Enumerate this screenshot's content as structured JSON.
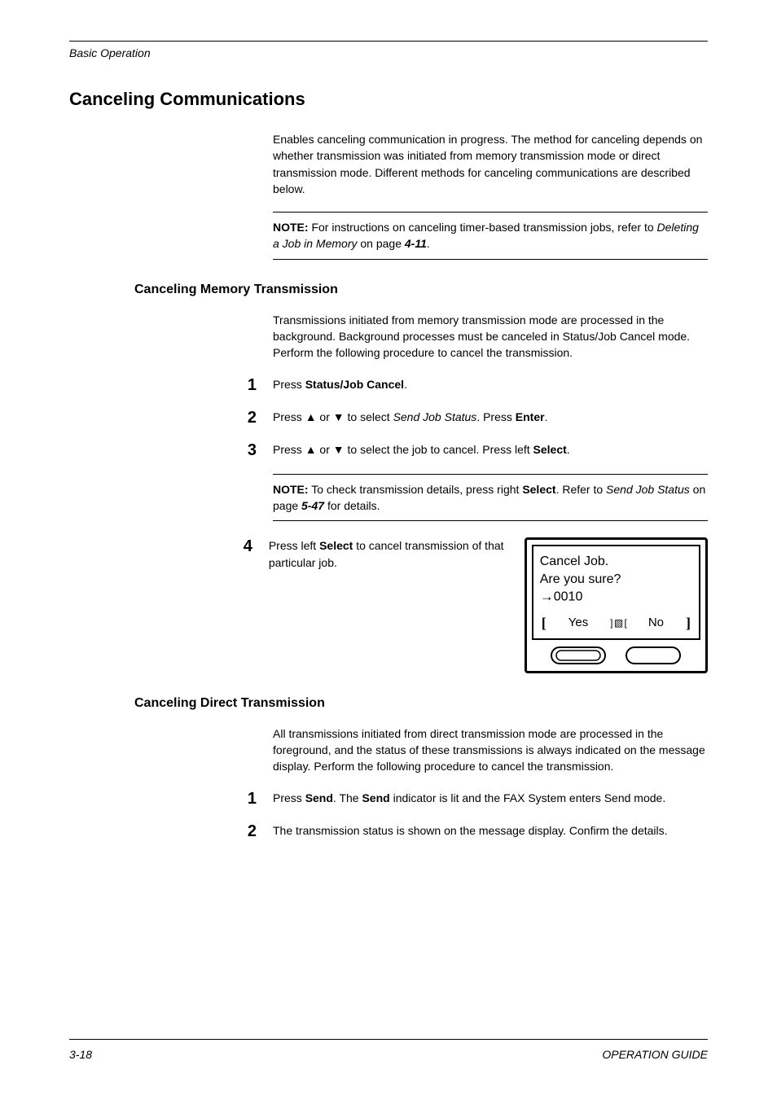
{
  "header": {
    "running": "Basic Operation"
  },
  "title": "Canceling Communications",
  "intro": "Enables canceling communication in progress. The method for canceling depends on whether transmission was initiated from memory transmission mode or direct transmission mode. Different methods for canceling communications are described below.",
  "note1_prefix": "NOTE:",
  "note1_body": " For instructions on canceling timer-based transmission jobs, refer to ",
  "note1_link": "Deleting a Job in Memory",
  "note1_rest": " on page ",
  "note1_page": "4-11",
  "note1_end": ".",
  "section1": {
    "title": "Canceling Memory Transmission",
    "intro": "Transmissions initiated from memory transmission mode are processed in the background. Background processes must be canceled in Status/Job Cancel mode. Perform the following procedure to cancel the transmission.",
    "step1_num": "1",
    "step1_a": "Press ",
    "step1_b": "Status/Job Cancel",
    "step1_c": ".",
    "step2_num": "2",
    "step2_a": "Press ",
    "step2_b": " or ",
    "step2_c": " to select ",
    "step2_d": "Send Job Status",
    "step2_e": ". Press ",
    "step2_f": "Enter",
    "step2_g": ".",
    "step3_num": "3",
    "step3_a": "Press ",
    "step3_b": " or ",
    "step3_c": " to select the job to cancel. Press left ",
    "step3_d": "Select",
    "step3_e": ".",
    "note2_prefix": "NOTE:",
    "note2_body": " To check transmission details, press right ",
    "note2_bold": "Select",
    "note2_mid": ". Refer to ",
    "note2_link": "Send Job Status",
    "note2_rest": " on page ",
    "note2_page": "5-47",
    "note2_end": " for details.",
    "step4_num": "4",
    "step4_a": "Press left ",
    "step4_b": "Select",
    "step4_c": " to cancel transmission of that particular job."
  },
  "lcd": {
    "line1": "Cancel Job.",
    "line2": "Are you sure?",
    "line3": "0010",
    "yes": "Yes",
    "no": "No"
  },
  "section2": {
    "title": "Canceling Direct Transmission",
    "intro": "All transmissions initiated from direct transmission mode are processed in the foreground, and the status of these transmissions is always indicated on the message display. Perform the following procedure to cancel the transmission.",
    "step1_num": "1",
    "step1_a": "Press ",
    "step1_b": "Send",
    "step1_c": ". The ",
    "step1_d": "Send",
    "step1_e": " indicator is lit and the FAX System enters Send mode.",
    "step2_num": "2",
    "step2_text": "The transmission status is shown on the message display. Confirm the details."
  },
  "footer": {
    "left": "3-18",
    "right": "OPERATION GUIDE"
  }
}
